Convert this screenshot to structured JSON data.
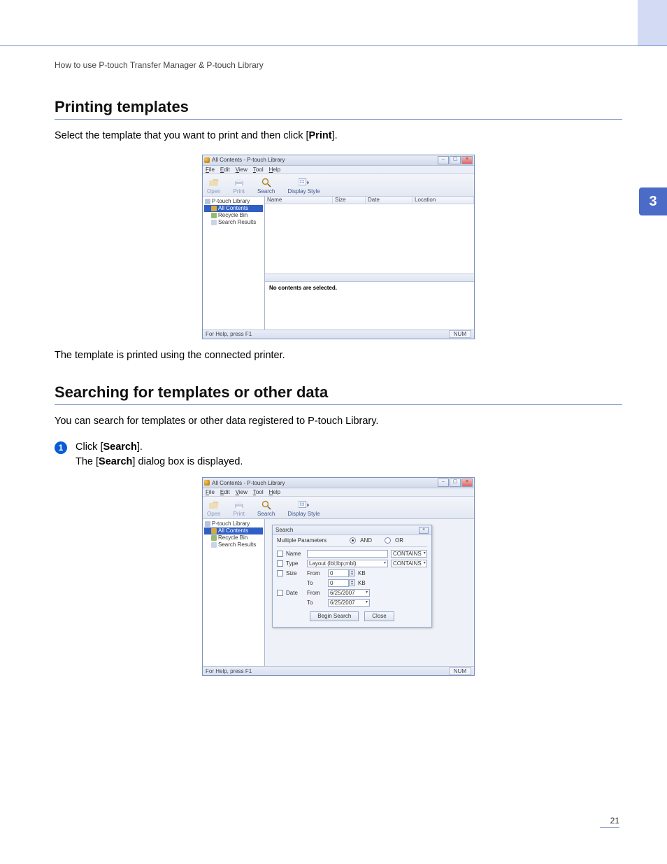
{
  "breadcrumb": "How to use P-touch Transfer Manager & P-touch Library",
  "chapter_tab": "3",
  "page_number": "21",
  "section1": {
    "heading": "Printing templates",
    "intro_pre": "Select the template that you want to print and then click [",
    "intro_bold": "Print",
    "intro_post": "].",
    "outro": "The template is printed using the connected printer."
  },
  "section2": {
    "heading": "Searching for templates or other data",
    "intro": "You can search for templates or other data registered to P-touch Library.",
    "step1_num": "1",
    "step1_line1_pre": "Click [",
    "step1_line1_bold": "Search",
    "step1_line1_post": "].",
    "step1_line2_pre": "The [",
    "step1_line2_bold": "Search",
    "step1_line2_post": "] dialog box is displayed."
  },
  "app": {
    "title": "All Contents - P-touch Library",
    "menus": {
      "file": "File",
      "edit": "Edit",
      "view": "View",
      "tool": "Tool",
      "help": "Help"
    },
    "toolbar": {
      "open": "Open",
      "print": "Print",
      "search": "Search",
      "display": "Display Style"
    },
    "tree": {
      "root": "P-touch Library",
      "all": "All Contents",
      "bin": "Recycle Bin",
      "results": "Search Results"
    },
    "cols": {
      "name": "Name",
      "size": "Size",
      "date": "Date",
      "path": "Location"
    },
    "preview_empty": "No contents are selected.",
    "status_left": "For Help, press F1",
    "status_right": "NUM"
  },
  "search": {
    "title": "Search",
    "params": "Multiple Parameters",
    "logic_and": "AND",
    "logic_or": "OR",
    "row_name": "Name",
    "row_type": "Type",
    "row_size": "Size",
    "row_date": "Date",
    "type_value": "Layout (lbl;lbp;mbl)",
    "contains": "CONTAINS",
    "from": "From",
    "to": "To",
    "size_from": "0",
    "size_to": "0",
    "kb": "KB",
    "date_from": "6/25/2007",
    "date_to": "6/25/2007",
    "btn_begin": "Begin Search",
    "btn_close": "Close"
  }
}
